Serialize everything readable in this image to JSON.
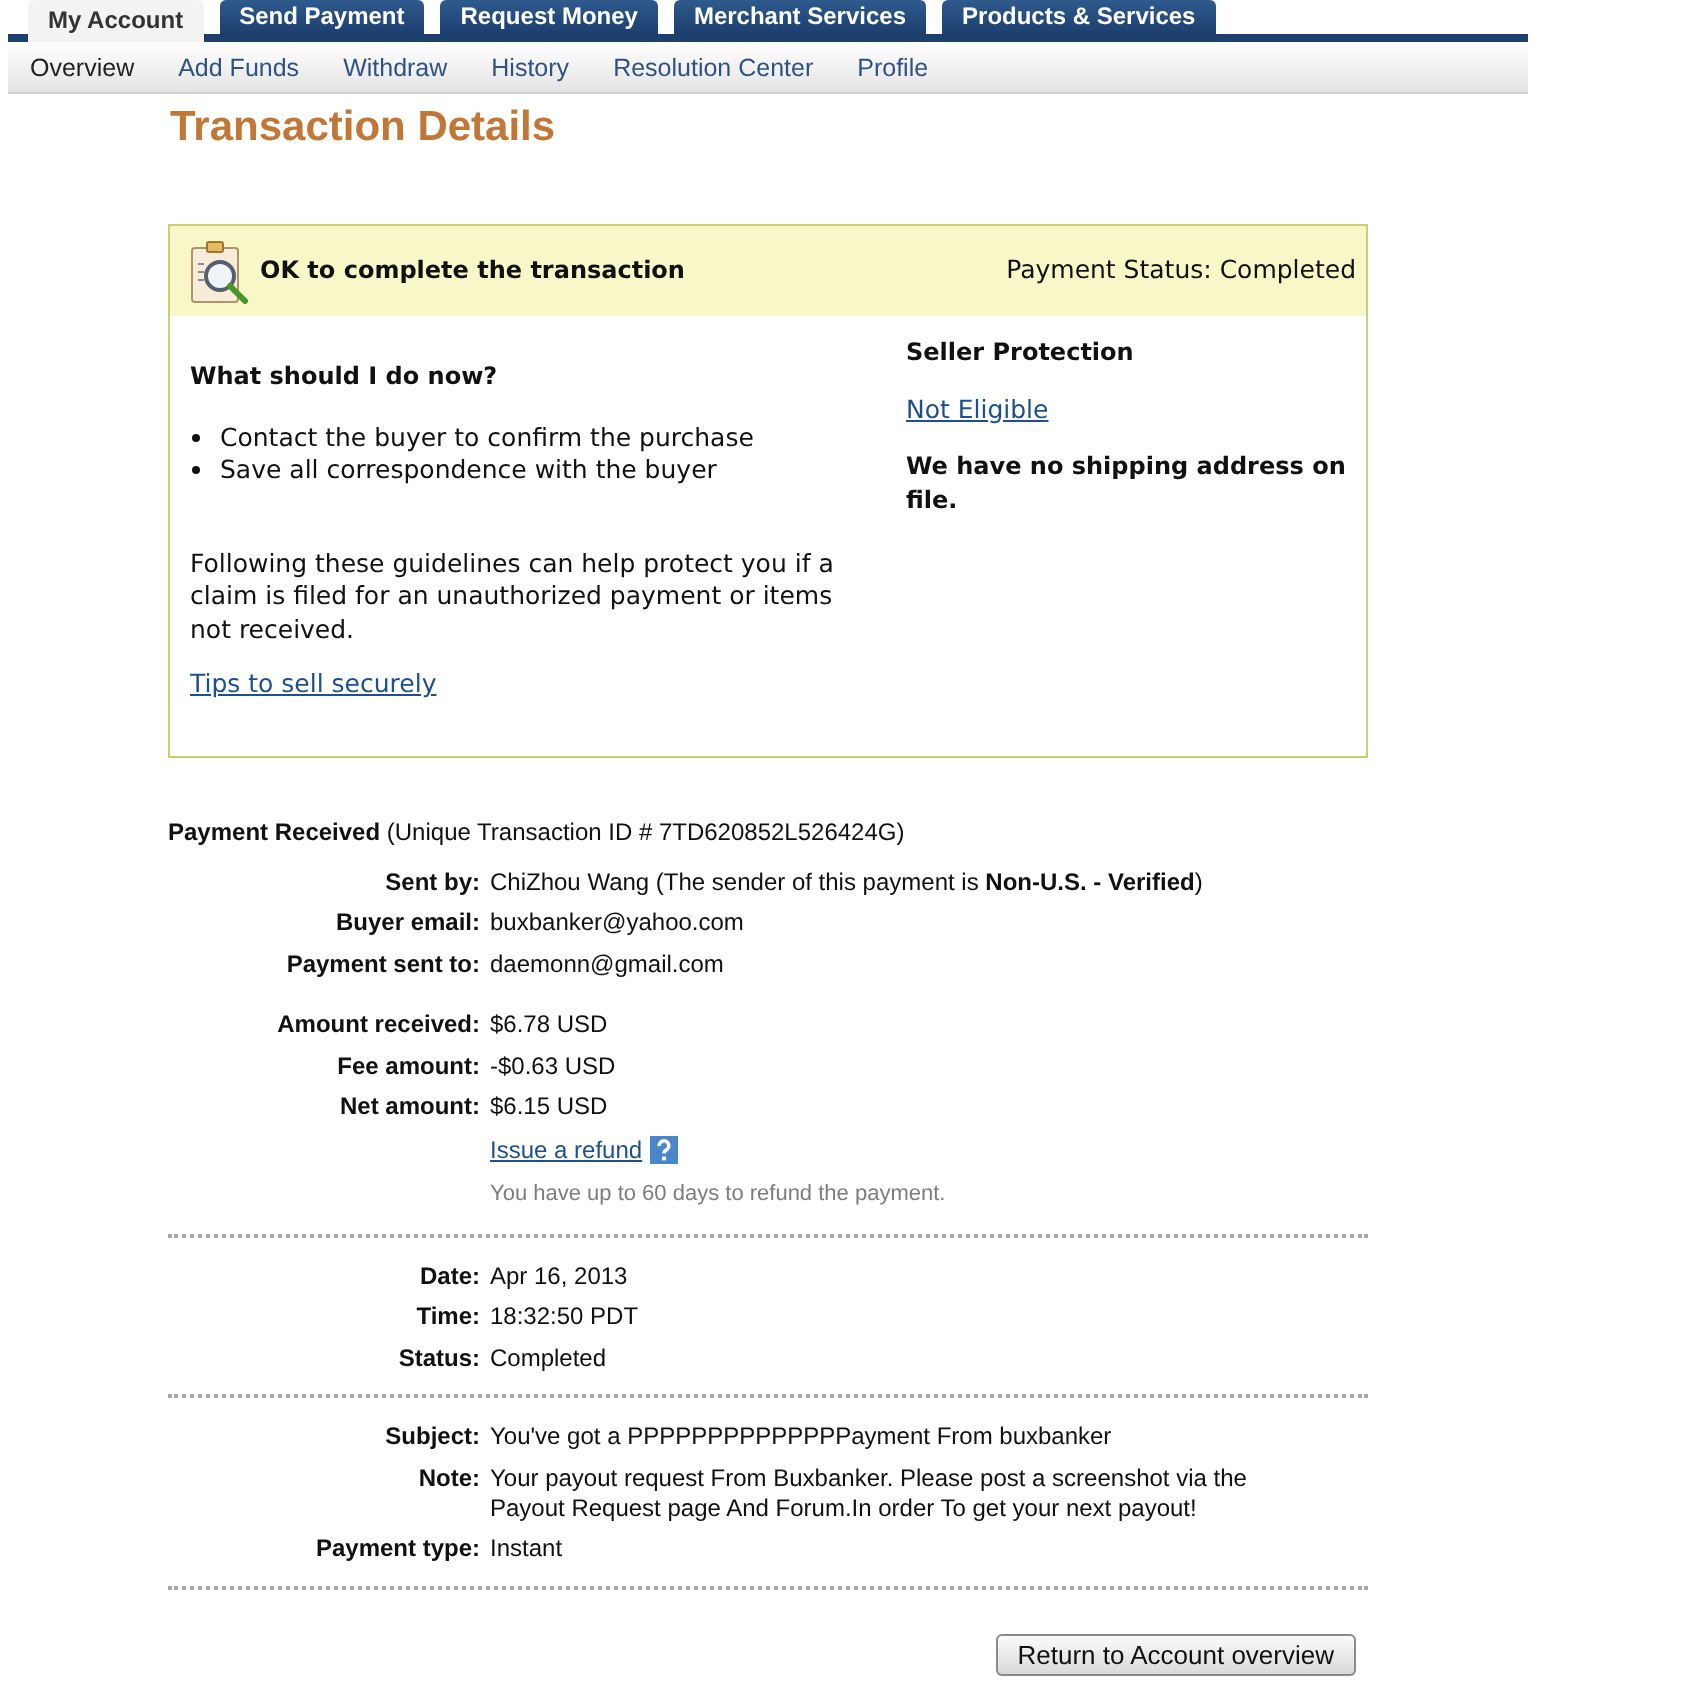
{
  "top_tabs": [
    {
      "label": "My Account",
      "selected": true
    },
    {
      "label": "Send Payment",
      "selected": false
    },
    {
      "label": "Request Money",
      "selected": false
    },
    {
      "label": "Merchant Services",
      "selected": false
    },
    {
      "label": "Products & Services",
      "selected": false
    }
  ],
  "sub_nav": [
    {
      "label": "Overview",
      "selected": true
    },
    {
      "label": "Add Funds",
      "selected": false
    },
    {
      "label": "Withdraw",
      "selected": false
    },
    {
      "label": "History",
      "selected": false
    },
    {
      "label": "Resolution Center",
      "selected": false
    },
    {
      "label": "Profile",
      "selected": false
    }
  ],
  "page_title": "Transaction Details",
  "status_box": {
    "title": "OK to complete the transaction",
    "payment_status": "Payment Status: Completed",
    "guidance": {
      "heading": "What should I do now?",
      "bullets": [
        "Contact the buyer to confirm the purchase",
        "Save all correspondence with the buyer"
      ],
      "paragraph": "Following these guidelines can help protect you if a claim is filed for an unauthorized payment or items not received.",
      "link": "Tips to sell securely"
    },
    "seller_protection": {
      "heading": "Seller Protection",
      "status_link": "Not Eligible",
      "shipping_note": "We have no shipping address on file."
    }
  },
  "payment": {
    "heading": "**Payment Received** (Unique Transaction ID # 7TD620852L526424G)",
    "sections": [
      {
        "groups": [
          {
            "rows": [
              {
                "label": "Sent by:",
                "value": "ChiZhou Wang (The sender of this payment is **Non-U.S. - Verified**)"
              },
              {
                "label": "Buyer email:",
                "value": "buxbanker@yahoo.com"
              },
              {
                "label": "Payment sent to:",
                "value": "daemonn@gmail.com"
              }
            ]
          },
          {
            "rows": [
              {
                "label": "Amount received:",
                "value": "$6.78 USD"
              },
              {
                "label": "Fee amount:",
                "value": "-$0.63 USD"
              },
              {
                "label": "Net amount:",
                "value": "$6.15 USD"
              }
            ]
          }
        ],
        "refund": {
          "link": "Issue a refund",
          "note": "You have up to 60 days to refund the payment."
        }
      },
      {
        "groups": [
          {
            "rows": [
              {
                "label": "Date:",
                "value": "Apr 16, 2013"
              },
              {
                "label": "Time:",
                "value": "18:32:50 PDT"
              },
              {
                "label": "Status:",
                "value": "Completed"
              }
            ]
          }
        ]
      },
      {
        "groups": [
          {
            "rows": [
              {
                "label": "Subject:",
                "value": "You've got a PPPPPPPPPPPPPPayment From buxbanker"
              },
              {
                "label": "Note:",
                "value": "Your payout request From Buxbanker. Please post a screenshot via the Payout Request page And Forum.In order To get your next payout!"
              },
              {
                "label": "Payment type:",
                "value": "Instant"
              }
            ]
          }
        ]
      }
    ]
  },
  "button": "Return to Account overview"
}
